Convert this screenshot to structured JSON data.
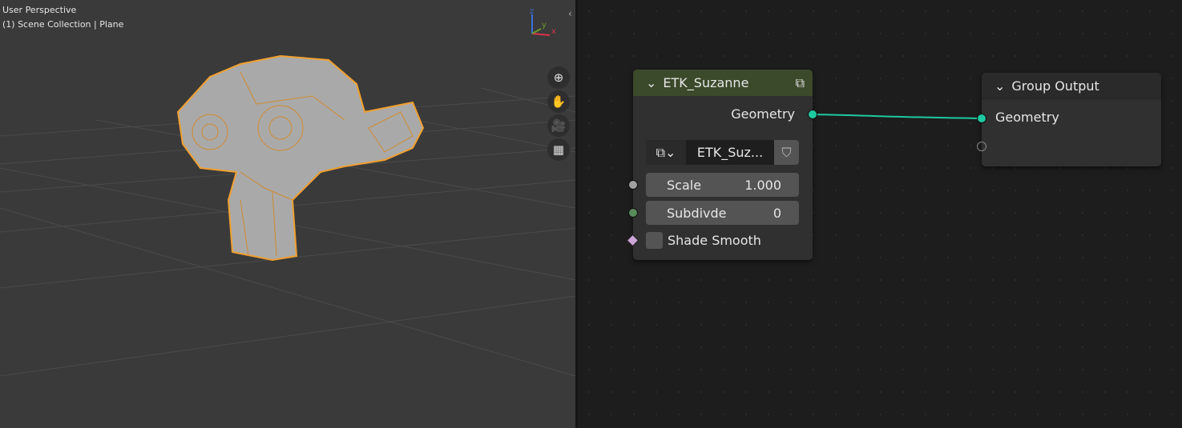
{
  "viewport": {
    "mode": "User Perspective",
    "collection": "(1) Scene Collection | Plane",
    "axes": {
      "x": "x",
      "y": "y",
      "z": "z"
    },
    "nav_icons": [
      "zoom-icon",
      "hand-pan-icon",
      "camera-icon",
      "grid-perspective-icon"
    ],
    "wire_color": "#f0a030"
  },
  "node": {
    "title": "ETK_Suzanne",
    "header_color": "#3b4a2a",
    "output": "Geometry",
    "group_name": "ETK_Suz...",
    "scale_label": "Scale",
    "scale_value": "1.000",
    "subdiv_label": "Subdivde",
    "subdiv_value": "0",
    "shade_label": "Shade Smooth",
    "shade_checked": false
  },
  "output_node": {
    "title": "Group Output",
    "input": "Geometry"
  },
  "link_color": "#1fc9a0"
}
